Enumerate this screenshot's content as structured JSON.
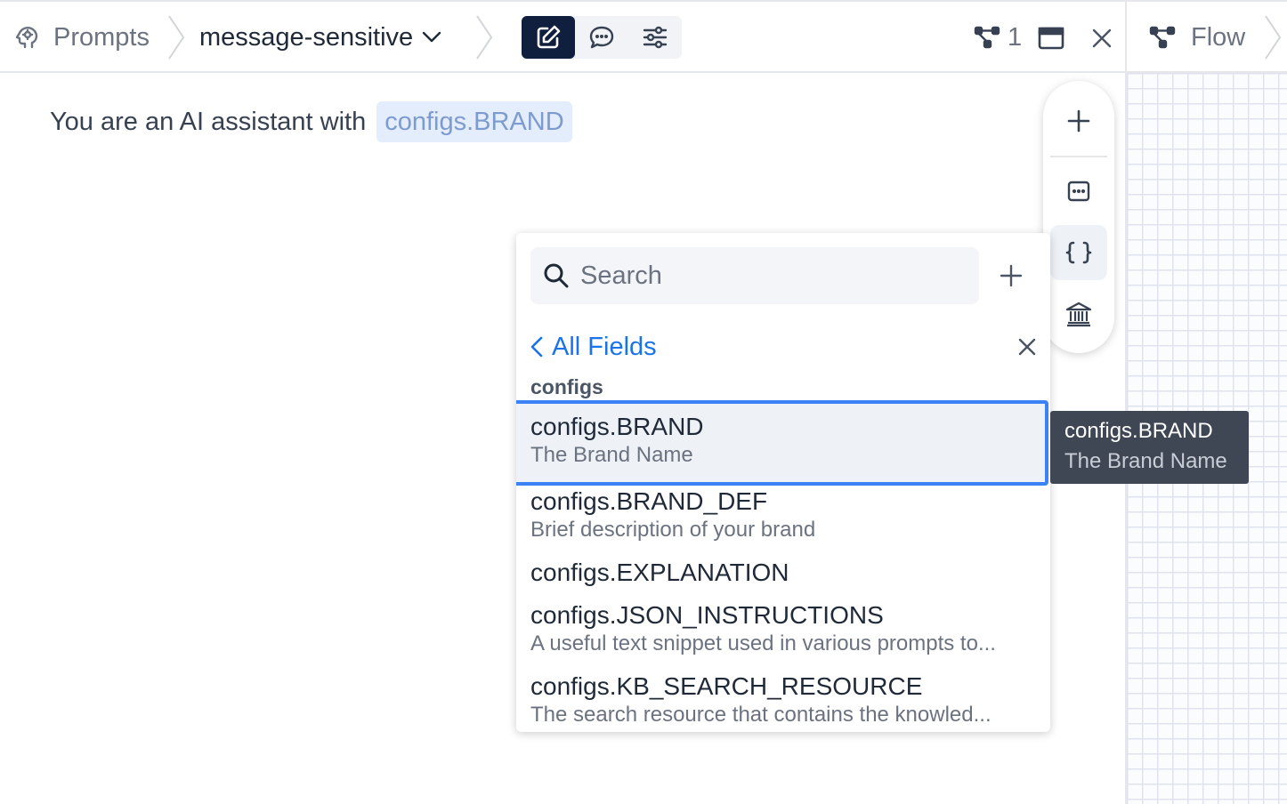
{
  "breadcrumb": {
    "root_label": "Prompts",
    "current_label": "message-sensitive"
  },
  "header": {
    "modes": [
      {
        "name": "edit",
        "icon": "pencil-square-icon",
        "active": true
      },
      {
        "name": "chat",
        "icon": "chat-bubble-icon",
        "active": false
      },
      {
        "name": "settings",
        "icon": "sliders-icon",
        "active": false
      }
    ],
    "flow_count": "1"
  },
  "flow_panel": {
    "title": "Flow"
  },
  "editor": {
    "text": "You are an AI assistant with",
    "variable_chip": "configs.BRAND"
  },
  "side_toolbar": {
    "buttons": [
      "plus-icon",
      "message-box-icon",
      "braces-icon",
      "bank-icon"
    ],
    "active": "braces-icon"
  },
  "dropdown": {
    "search_placeholder": "Search",
    "search_value": "",
    "back_label": "All Fields",
    "group_label": "configs",
    "items": [
      {
        "name": "configs.BRAND",
        "description": "The Brand Name",
        "selected": true
      },
      {
        "name": "configs.BRAND_DEF",
        "description": "Brief description of your brand"
      },
      {
        "name": "configs.EXPLANATION",
        "description": ""
      },
      {
        "name": "configs.JSON_INSTRUCTIONS",
        "description": "A useful text snippet used in various prompts to..."
      },
      {
        "name": "configs.KB_SEARCH_RESOURCE",
        "description": "The search resource that contains the knowled..."
      }
    ]
  },
  "tooltip": {
    "title": "configs.BRAND",
    "subtitle": "The Brand Name"
  },
  "colors": {
    "accent": "#1a73e8",
    "active_mode_bg": "#0f1f3d",
    "selection_border": "#3b82f6",
    "chip_bg": "#e3edfb",
    "chip_text": "#7e9bd0",
    "tooltip_bg": "#3f4654"
  }
}
